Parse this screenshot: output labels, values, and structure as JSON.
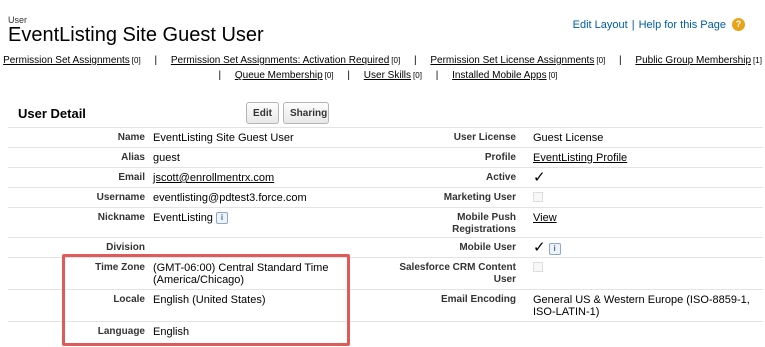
{
  "header": {
    "page_type": "User",
    "title": "EventListing Site Guest User",
    "edit_layout": "Edit Layout",
    "separator": "|",
    "help_link": "Help for this Page",
    "help_icon": "?"
  },
  "related_links": {
    "row1": [
      {
        "label": "Permission Set Assignments",
        "count": "[0]"
      },
      {
        "label": "Permission Set Assignments: Activation Required",
        "count": "[0]"
      },
      {
        "label": "Permission Set License Assignments",
        "count": "[0]"
      },
      {
        "label": "Public Group Membership",
        "count": "[1]"
      }
    ],
    "row2": [
      {
        "label": "Queue Membership",
        "count": "[0]"
      },
      {
        "label": "User Skills",
        "count": "[0]"
      },
      {
        "label": "Installed Mobile Apps",
        "count": "[0]"
      }
    ],
    "pipe": "|"
  },
  "section": {
    "title": "User Detail",
    "edit_button": "Edit",
    "sharing_button": "Sharing"
  },
  "rows": [
    {
      "label1": "Name",
      "value1": "EventListing Site Guest User",
      "label2": "User License",
      "value2": "Guest License"
    },
    {
      "label1": "Alias",
      "value1": "guest",
      "label2": "Profile",
      "value2": "EventListing Profile"
    },
    {
      "label1": "Email",
      "value1": "jscott@enrollmentrx.com",
      "label2": "Active",
      "value2": "✓"
    },
    {
      "label1": "Username",
      "value1": "eventlisting@pdtest3.force.com",
      "label2": "Marketing User",
      "value2": ""
    },
    {
      "label1": "Nickname",
      "value1": "EventListing",
      "label2": "Mobile Push Registrations",
      "value2": "View"
    },
    {
      "label1": "Division",
      "value1": "",
      "label2": "Mobile User",
      "value2": "✓"
    },
    {
      "label1": "Time Zone",
      "value1": "(GMT-06:00) Central Standard Time (America/Chicago)",
      "label2": "Salesforce CRM Content User",
      "value2": ""
    },
    {
      "label1": "Locale",
      "value1": "English (United States)",
      "label2": "Email Encoding",
      "value2": "General US & Western Europe (ISO-8859-1, ISO-LATIN-1)"
    },
    {
      "label1": "Language",
      "value1": "English",
      "label2": "",
      "value2": ""
    }
  ],
  "info_icon": "i",
  "colors": {
    "link_blue": "#015ba7",
    "help_orange": "#e8a318",
    "highlight_red": "#e05a5a"
  }
}
